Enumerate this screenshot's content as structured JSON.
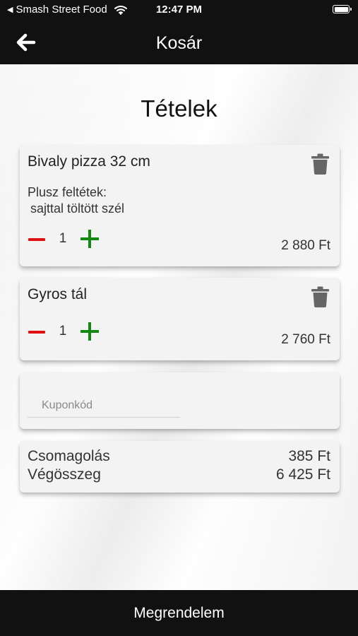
{
  "status_bar": {
    "back_app": "Smash Street Food",
    "time": "12:47 PM"
  },
  "header": {
    "title": "Kosár",
    "back_icon": "arrow-left-icon"
  },
  "main": {
    "section_title": "Tételek",
    "items": [
      {
        "name": "Bivaly pizza 32 cm",
        "extras_label": "Plusz feltétek:",
        "extras": "sajttal töltött szél",
        "quantity": "1",
        "price": "2 880 Ft"
      },
      {
        "name": "Gyros tál",
        "quantity": "1",
        "price": "2 760 Ft"
      }
    ],
    "coupon": {
      "placeholder": "Kuponkód",
      "value": ""
    },
    "summary": {
      "packaging_label": "Csomagolás",
      "packaging_value": "385 Ft",
      "total_label": "Végösszeg",
      "total_value": "6 425 Ft"
    }
  },
  "footer": {
    "order_button": "Megrendelem"
  },
  "colors": {
    "bar_background": "#111111",
    "minus": "#e01010",
    "plus": "#128a12",
    "trash": "#666666"
  }
}
